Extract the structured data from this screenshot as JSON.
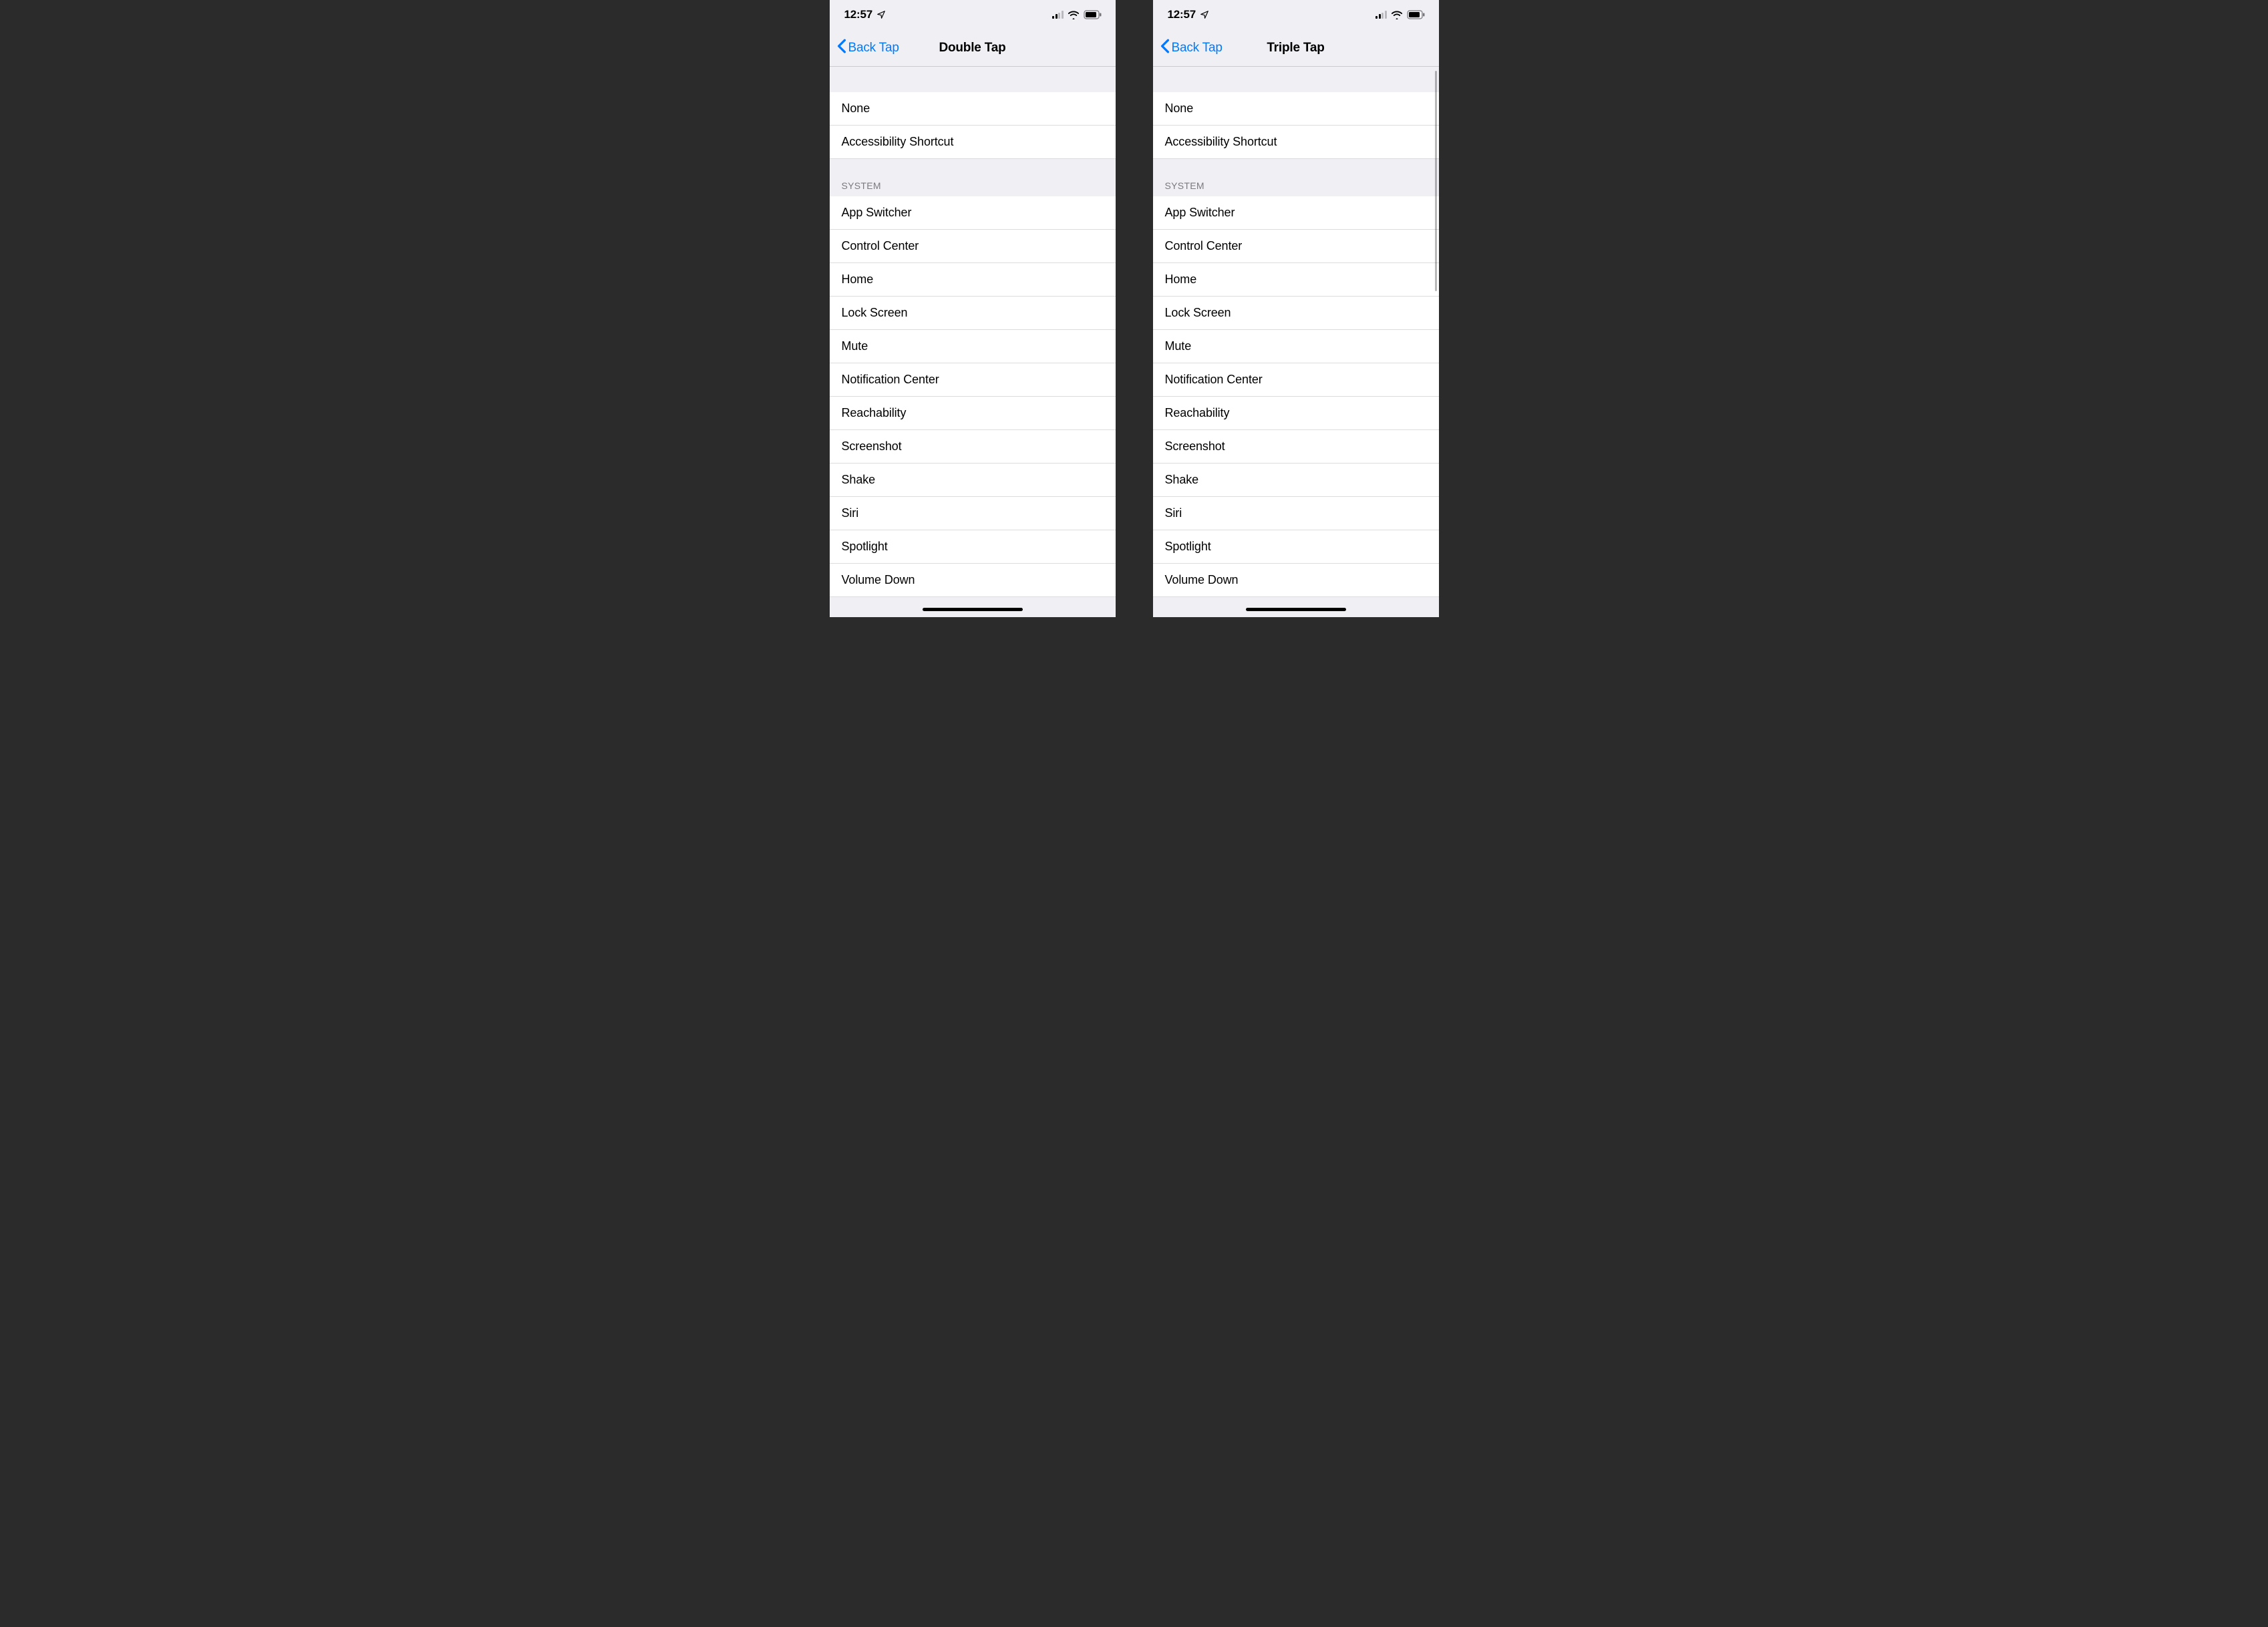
{
  "status": {
    "time": "12:57",
    "location_icon": "location-arrow",
    "signal_strength": 2,
    "signal_total": 4,
    "wifi_bars": 3,
    "battery_pct_approx": "about 80%"
  },
  "screens": [
    {
      "id": "double-tap-screen",
      "back_label": "Back Tap",
      "title": "Double Tap",
      "show_scrollbar": false,
      "sections": [
        {
          "header": null,
          "items": [
            "None",
            "Accessibility Shortcut"
          ]
        },
        {
          "header": "SYSTEM",
          "items": [
            "App Switcher",
            "Control Center",
            "Home",
            "Lock Screen",
            "Mute",
            "Notification Center",
            "Reachability",
            "Screenshot",
            "Shake",
            "Siri",
            "Spotlight",
            "Volume Down"
          ]
        }
      ]
    },
    {
      "id": "triple-tap-screen",
      "back_label": "Back Tap",
      "title": "Triple Tap",
      "show_scrollbar": true,
      "sections": [
        {
          "header": null,
          "items": [
            "None",
            "Accessibility Shortcut"
          ]
        },
        {
          "header": "SYSTEM",
          "items": [
            "App Switcher",
            "Control Center",
            "Home",
            "Lock Screen",
            "Mute",
            "Notification Center",
            "Reachability",
            "Screenshot",
            "Shake",
            "Siri",
            "Spotlight",
            "Volume Down"
          ]
        }
      ]
    }
  ]
}
